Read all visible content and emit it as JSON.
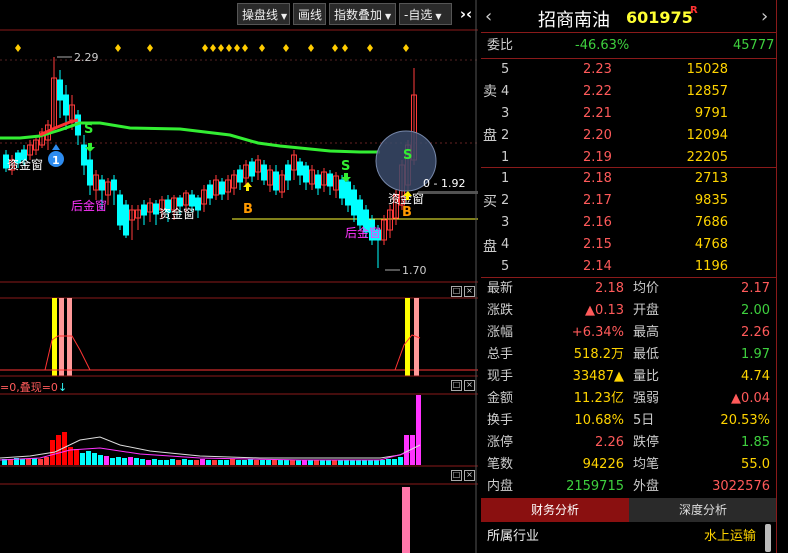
{
  "toolbar": {
    "btn1": "操盘线",
    "btn2": "画线",
    "btn3": "指数叠加",
    "btn4": "自选",
    "btn4_prefix": "-"
  },
  "chart": {
    "high_label": "2.29",
    "low_label": "1.70",
    "range_label": "0 - 1.92",
    "signals": {
      "s1": "S",
      "s2": "S",
      "b1": "B",
      "b2": "B",
      "zj1": "资金窗",
      "zj2": "资金窗",
      "zj3": "资金窗",
      "hj1": "后金窗",
      "hj2": "后金窗",
      "badge": "1"
    },
    "indicator2_title": "=0,叠现=0"
  },
  "colors": {
    "up": "#ff3b3b",
    "down": "#00ffff",
    "ma": "#33ee33",
    "magenta": "#ff22ff",
    "yellow": "#ffff00",
    "pink": "#ff9999"
  },
  "quote": {
    "name": "招商南油",
    "code": "601975",
    "flag": "R",
    "weibi_label": "委比",
    "weibi_pct": "-46.63%",
    "weicha": "45777",
    "sell_label": "卖",
    "sell_label2": "盘",
    "buy_label": "买",
    "buy_label2": "盘",
    "sells": [
      {
        "lvl": "5",
        "price": "2.23",
        "vol": "15028"
      },
      {
        "lvl": "4",
        "price": "2.22",
        "vol": "12857"
      },
      {
        "lvl": "3",
        "price": "2.21",
        "vol": "9791"
      },
      {
        "lvl": "2",
        "price": "2.20",
        "vol": "12094"
      },
      {
        "lvl": "1",
        "price": "2.19",
        "vol": "22205"
      }
    ],
    "buys": [
      {
        "lvl": "1",
        "price": "2.18",
        "vol": "2713"
      },
      {
        "lvl": "2",
        "price": "2.17",
        "vol": "9835"
      },
      {
        "lvl": "3",
        "price": "2.16",
        "vol": "7686"
      },
      {
        "lvl": "4",
        "price": "2.15",
        "vol": "4768"
      },
      {
        "lvl": "5",
        "price": "2.14",
        "vol": "1196"
      }
    ],
    "stats": [
      {
        "l1": "最新",
        "v1": "2.18",
        "c1": "red",
        "l2": "均价",
        "v2": "2.17",
        "c2": "red"
      },
      {
        "l1": "涨跌",
        "v1": "▲0.13",
        "c1": "red",
        "l2": "开盘",
        "v2": "2.00",
        "c2": "green"
      },
      {
        "l1": "涨幅",
        "v1": "+6.34%",
        "c1": "red",
        "l2": "最高",
        "v2": "2.26",
        "c2": "red"
      },
      {
        "l1": "总手",
        "v1": "518.2万",
        "c1": "yel",
        "l2": "最低",
        "v2": "1.97",
        "c2": "green"
      },
      {
        "l1": "现手",
        "v1": "33487▲",
        "c1": "yel",
        "l2": "量比",
        "v2": "4.74",
        "c2": "yel"
      },
      {
        "l1": "金额",
        "v1": "11.23亿",
        "c1": "yel",
        "l2": "强弱",
        "v2": "▲0.04",
        "c2": "red"
      },
      {
        "l1": "换手",
        "v1": "10.68%",
        "c1": "yel",
        "l2": "5日",
        "v2": "20.53%",
        "c2": "yel"
      },
      {
        "l1": "涨停",
        "v1": "2.26",
        "c1": "red",
        "l2": "跌停",
        "v2": "1.85",
        "c2": "green"
      },
      {
        "l1": "笔数",
        "v1": "94226",
        "c1": "yel",
        "l2": "均笔",
        "v2": "55.0",
        "c2": "yel"
      },
      {
        "l1": "内盘",
        "v1": "2159715",
        "c1": "green",
        "l2": "外盘",
        "v2": "3022576",
        "c2": "red"
      }
    ],
    "tab1": "财务分析",
    "tab2": "深度分析",
    "industry_label": "所属行业",
    "industry_value": "水上运输"
  }
}
